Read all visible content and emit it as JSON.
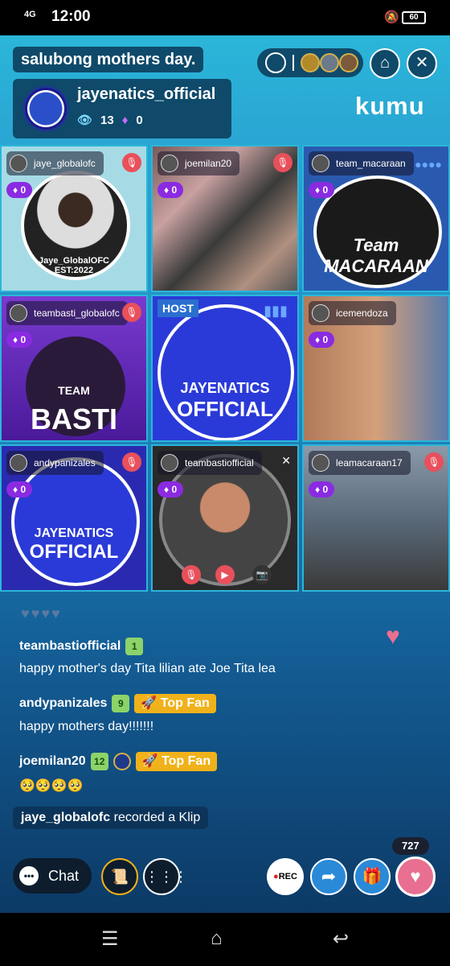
{
  "status_bar": {
    "signal": "4G",
    "time": "12:00",
    "battery": "60"
  },
  "room_title": "salubong mothers day.",
  "host": {
    "name": "jayenatics_official",
    "viewers": "13",
    "diamonds": "0"
  },
  "brand": "kumu",
  "tiles": [
    {
      "user": "jaye_globalofc",
      "gems": "0",
      "overlay": "Jaye_GlobalOFC\nEST:2022"
    },
    {
      "user": "joemilan20",
      "gems": "0"
    },
    {
      "user": "team_macaraan",
      "gems": "0",
      "overlay": "Team MACARAAN"
    },
    {
      "user": "teambasti_globalofc",
      "gems": "0",
      "overlay": "TEAM BASTI GLOBALOFC"
    },
    {
      "host_label": "HOST",
      "overlay": "JAYENATICS OFFICIAL"
    },
    {
      "user": "icemendoza",
      "gems": "0"
    },
    {
      "user": "andypanizales",
      "gems": "0",
      "overlay": "JAYENATICS OFFICIAL"
    },
    {
      "user": "teambastiofficial",
      "gems": "0"
    },
    {
      "user": "leamacaraan17",
      "gems": "0"
    }
  ],
  "comments": [
    {
      "user": "teambastiofficial",
      "level": "1",
      "text": "happy mother's day Tita lilian ate Joe Tita lea"
    },
    {
      "user": "andypanizales",
      "level": "9",
      "fan": "🚀 Top Fan",
      "text": "happy mothers day!!!!!!!"
    },
    {
      "user": "joemilan20",
      "level": "12",
      "fan": "🚀 Top Fan",
      "text": "🥺🥺🥺🥺"
    }
  ],
  "klip": {
    "user": "jaye_globalofc",
    "text": "recorded a Klip"
  },
  "heart_count": "727",
  "controls": {
    "chat": "Chat",
    "rec": "REC"
  },
  "colors": {
    "accent": "#2bb6d9",
    "gem": "#8a2be2",
    "heart": "#e86f90",
    "top_fan": "#f0b21a"
  }
}
